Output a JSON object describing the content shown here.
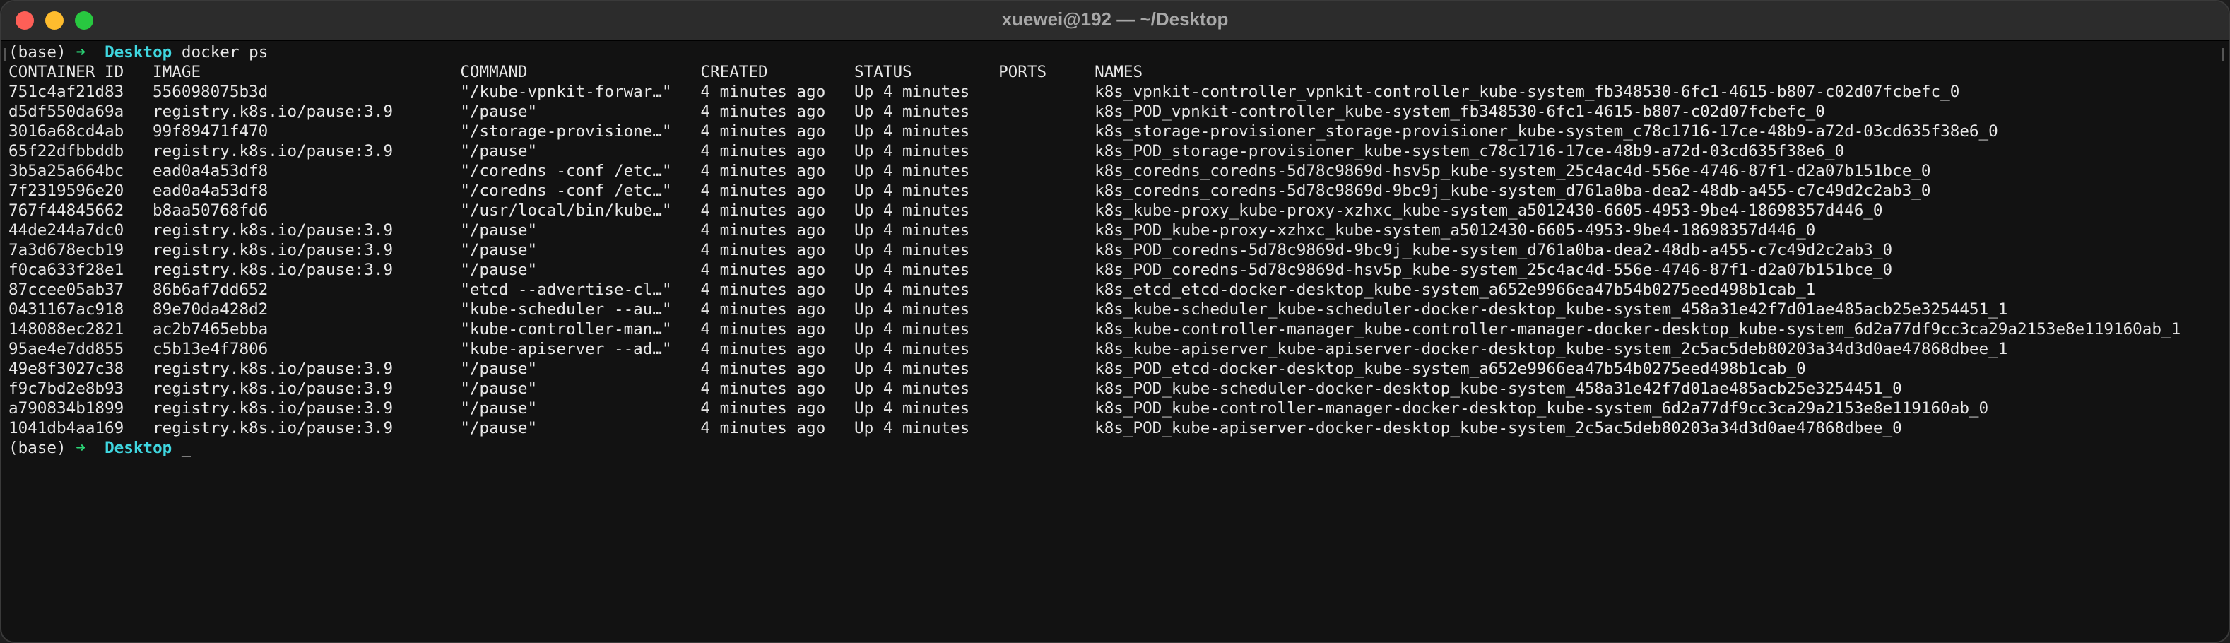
{
  "window": {
    "title": "xuewei@192 — ~/Desktop"
  },
  "prompt1": {
    "env": "(base)",
    "arrow": "➜",
    "dir": "Desktop",
    "command": "docker ps"
  },
  "header": "CONTAINER ID   IMAGE                           COMMAND                  CREATED         STATUS         PORTS     NAMES",
  "rows": [
    "751c4af21d83   556098075b3d                    \"/kube-vpnkit-forwar…\"   4 minutes ago   Up 4 minutes             k8s_vpnkit-controller_vpnkit-controller_kube-system_fb348530-6fc1-4615-b807-c02d07fcbefc_0",
    "d5df550da69a   registry.k8s.io/pause:3.9       \"/pause\"                 4 minutes ago   Up 4 minutes             k8s_POD_vpnkit-controller_kube-system_fb348530-6fc1-4615-b807-c02d07fcbefc_0",
    "3016a68cd4ab   99f89471f470                    \"/storage-provisione…\"   4 minutes ago   Up 4 minutes             k8s_storage-provisioner_storage-provisioner_kube-system_c78c1716-17ce-48b9-a72d-03cd635f38e6_0",
    "65f22dfbbddb   registry.k8s.io/pause:3.9       \"/pause\"                 4 minutes ago   Up 4 minutes             k8s_POD_storage-provisioner_kube-system_c78c1716-17ce-48b9-a72d-03cd635f38e6_0",
    "3b5a25a664bc   ead0a4a53df8                    \"/coredns -conf /etc…\"   4 minutes ago   Up 4 minutes             k8s_coredns_coredns-5d78c9869d-hsv5p_kube-system_25c4ac4d-556e-4746-87f1-d2a07b151bce_0",
    "7f2319596e20   ead0a4a53df8                    \"/coredns -conf /etc…\"   4 minutes ago   Up 4 minutes             k8s_coredns_coredns-5d78c9869d-9bc9j_kube-system_d761a0ba-dea2-48db-a455-c7c49d2c2ab3_0",
    "767f44845662   b8aa50768fd6                    \"/usr/local/bin/kube…\"   4 minutes ago   Up 4 minutes             k8s_kube-proxy_kube-proxy-xzhxc_kube-system_a5012430-6605-4953-9be4-18698357d446_0",
    "44de244a7dc0   registry.k8s.io/pause:3.9       \"/pause\"                 4 minutes ago   Up 4 minutes             k8s_POD_kube-proxy-xzhxc_kube-system_a5012430-6605-4953-9be4-18698357d446_0",
    "7a3d678ecb19   registry.k8s.io/pause:3.9       \"/pause\"                 4 minutes ago   Up 4 minutes             k8s_POD_coredns-5d78c9869d-9bc9j_kube-system_d761a0ba-dea2-48db-a455-c7c49d2c2ab3_0",
    "f0ca633f28e1   registry.k8s.io/pause:3.9       \"/pause\"                 4 minutes ago   Up 4 minutes             k8s_POD_coredns-5d78c9869d-hsv5p_kube-system_25c4ac4d-556e-4746-87f1-d2a07b151bce_0",
    "87ccee05ab37   86b6af7dd652                    \"etcd --advertise-cl…\"   4 minutes ago   Up 4 minutes             k8s_etcd_etcd-docker-desktop_kube-system_a652e9966ea47b54b0275eed498b1cab_1",
    "0431167ac918   89e70da428d2                    \"kube-scheduler --au…\"   4 minutes ago   Up 4 minutes             k8s_kube-scheduler_kube-scheduler-docker-desktop_kube-system_458a31e42f7d01ae485acb25e3254451_1",
    "148088ec2821   ac2b7465ebba                    \"kube-controller-man…\"   4 minutes ago   Up 4 minutes             k8s_kube-controller-manager_kube-controller-manager-docker-desktop_kube-system_6d2a77df9cc3ca29a2153e8e119160ab_1",
    "95ae4e7dd855   c5b13e4f7806                    \"kube-apiserver --ad…\"   4 minutes ago   Up 4 minutes             k8s_kube-apiserver_kube-apiserver-docker-desktop_kube-system_2c5ac5deb80203a34d3d0ae47868dbee_1",
    "49e8f3027c38   registry.k8s.io/pause:3.9       \"/pause\"                 4 minutes ago   Up 4 minutes             k8s_POD_etcd-docker-desktop_kube-system_a652e9966ea47b54b0275eed498b1cab_0",
    "f9c7bd2e8b93   registry.k8s.io/pause:3.9       \"/pause\"                 4 minutes ago   Up 4 minutes             k8s_POD_kube-scheduler-docker-desktop_kube-system_458a31e42f7d01ae485acb25e3254451_0",
    "a790834b1899   registry.k8s.io/pause:3.9       \"/pause\"                 4 minutes ago   Up 4 minutes             k8s_POD_kube-controller-manager-docker-desktop_kube-system_6d2a77df9cc3ca29a2153e8e119160ab_0",
    "1041db4aa169   registry.k8s.io/pause:3.9       \"/pause\"                 4 minutes ago   Up 4 minutes             k8s_POD_kube-apiserver-docker-desktop_kube-system_2c5ac5deb80203a34d3d0ae47868dbee_0"
  ],
  "prompt2": {
    "env": "(base)",
    "arrow": "➜",
    "dir": "Desktop",
    "cursor": "_"
  },
  "colors": {
    "prompt_arrow": "#2bd576",
    "prompt_dir": "#3fd7e0",
    "text": "#e8e8e8",
    "background": "#121212",
    "titlebar": "#2c2c2c"
  }
}
